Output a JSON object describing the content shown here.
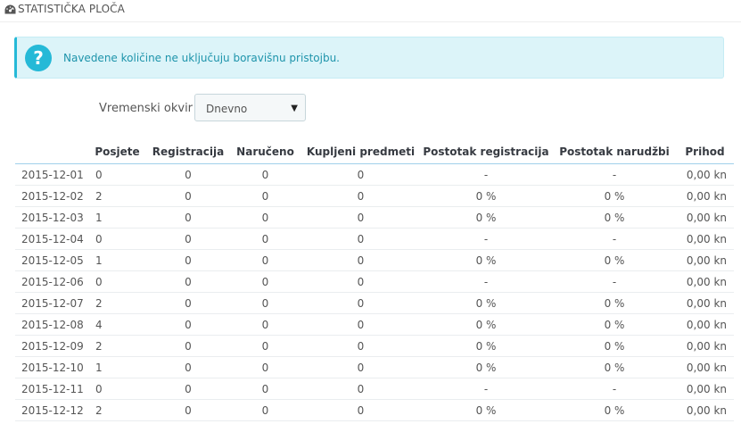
{
  "header": {
    "title": "Statistička ploča",
    "icon": "tachometer-icon"
  },
  "alert": {
    "icon": "question-circle-icon",
    "text": "Navedene količine ne uključuju boravišnu pristojbu.",
    "accent": "#25b9d7"
  },
  "filter": {
    "label": "Vremenski okvir",
    "selected": "Dnevno"
  },
  "table": {
    "columns": [
      "",
      "Posjete",
      "Registracija",
      "Naručeno",
      "Kupljeni predmeti",
      "Postotak registracija",
      "Postotak narudžbi",
      "Prihod"
    ],
    "rows": [
      [
        "2015-12-01",
        "0",
        "0",
        "0",
        "0",
        "-",
        "-",
        "0,00 kn"
      ],
      [
        "2015-12-02",
        "2",
        "0",
        "0",
        "0",
        "0 %",
        "0 %",
        "0,00 kn"
      ],
      [
        "2015-12-03",
        "1",
        "0",
        "0",
        "0",
        "0 %",
        "0 %",
        "0,00 kn"
      ],
      [
        "2015-12-04",
        "0",
        "0",
        "0",
        "0",
        "-",
        "-",
        "0,00 kn"
      ],
      [
        "2015-12-05",
        "1",
        "0",
        "0",
        "0",
        "0 %",
        "0 %",
        "0,00 kn"
      ],
      [
        "2015-12-06",
        "0",
        "0",
        "0",
        "0",
        "-",
        "-",
        "0,00 kn"
      ],
      [
        "2015-12-07",
        "2",
        "0",
        "0",
        "0",
        "0 %",
        "0 %",
        "0,00 kn"
      ],
      [
        "2015-12-08",
        "4",
        "0",
        "0",
        "0",
        "0 %",
        "0 %",
        "0,00 kn"
      ],
      [
        "2015-12-09",
        "2",
        "0",
        "0",
        "0",
        "0 %",
        "0 %",
        "0,00 kn"
      ],
      [
        "2015-12-10",
        "1",
        "0",
        "0",
        "0",
        "0 %",
        "0 %",
        "0,00 kn"
      ],
      [
        "2015-12-11",
        "0",
        "0",
        "0",
        "0",
        "-",
        "-",
        "0,00 kn"
      ],
      [
        "2015-12-12",
        "2",
        "0",
        "0",
        "0",
        "0 %",
        "0 %",
        "0,00 kn"
      ]
    ]
  }
}
